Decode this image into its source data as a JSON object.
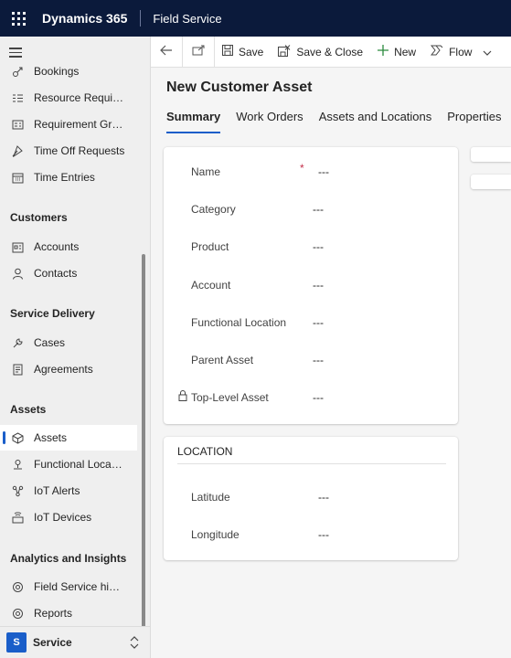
{
  "topbar": {
    "app_title": "Dynamics 365",
    "app_subtitle": "Field Service"
  },
  "sidebar": {
    "items_top": [
      {
        "label": "Bookings",
        "icon": "bookings-icon"
      },
      {
        "label": "Resource Requirements",
        "icon": "requirements-icon"
      },
      {
        "label": "Requirement Groups",
        "icon": "requirement-groups-icon"
      },
      {
        "label": "Time Off Requests",
        "icon": "time-off-icon"
      },
      {
        "label": "Time Entries",
        "icon": "calendar-icon"
      }
    ],
    "sections": [
      {
        "title": "Customers",
        "items": [
          {
            "label": "Accounts",
            "icon": "accounts-icon"
          },
          {
            "label": "Contacts",
            "icon": "person-icon"
          }
        ]
      },
      {
        "title": "Service Delivery",
        "items": [
          {
            "label": "Cases",
            "icon": "wrench-icon"
          },
          {
            "label": "Agreements",
            "icon": "document-icon"
          }
        ]
      },
      {
        "title": "Assets",
        "items": [
          {
            "label": "Assets",
            "icon": "asset-icon",
            "active": true
          },
          {
            "label": "Functional Locations",
            "icon": "location-icon"
          },
          {
            "label": "IoT Alerts",
            "icon": "iot-alert-icon"
          },
          {
            "label": "IoT Devices",
            "icon": "iot-device-icon"
          }
        ]
      },
      {
        "title": "Analytics and Insights",
        "items": [
          {
            "label": "Field Service historical analytics",
            "icon": "analytics-icon"
          },
          {
            "label": "Reports",
            "icon": "reports-icon"
          }
        ]
      }
    ],
    "area": {
      "badge": "S",
      "name": "Service"
    }
  },
  "commands": {
    "save": "Save",
    "save_close": "Save & Close",
    "new": "New",
    "flow": "Flow"
  },
  "form": {
    "title": "New Customer Asset",
    "tabs": [
      "Summary",
      "Work Orders",
      "Assets and Locations",
      "Properties"
    ],
    "active_tab": "Summary",
    "fields": [
      {
        "label": "Name",
        "value": "---",
        "required": true
      },
      {
        "label": "Category",
        "value": "---"
      },
      {
        "label": "Product",
        "value": "---"
      },
      {
        "label": "Account",
        "value": "---"
      },
      {
        "label": "Functional Location",
        "value": "---"
      },
      {
        "label": "Parent Asset",
        "value": "---"
      },
      {
        "label": "Top-Level Asset",
        "value": "---",
        "locked": true
      }
    ],
    "location_section": {
      "title": "LOCATION",
      "fields": [
        {
          "label": "Latitude",
          "value": "---"
        },
        {
          "label": "Longitude",
          "value": "---"
        }
      ]
    }
  },
  "colors": {
    "topbar_bg": "#0b1a3b",
    "accent": "#1a5ec9",
    "required": "#c4314b"
  }
}
